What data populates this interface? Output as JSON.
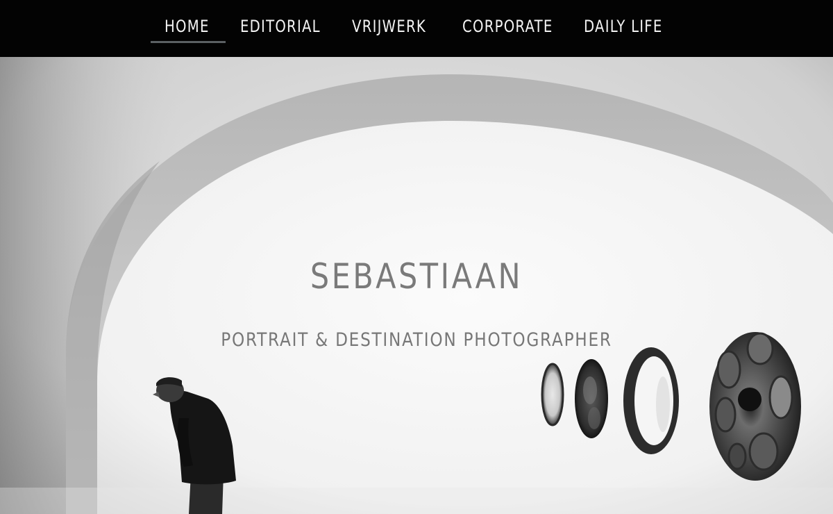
{
  "nav": {
    "items": [
      {
        "label": "HOME",
        "active": true
      },
      {
        "label": "EDITORIAL",
        "active": false
      },
      {
        "label": "VRIJWERK",
        "active": false
      },
      {
        "label": "CORPORATE",
        "active": false
      },
      {
        "label": "DAILY LIFE",
        "active": false
      }
    ]
  },
  "hero": {
    "title": "SEBASTIAAN",
    "subtitle": "PORTRAIT & DESTINATION PHOTOGRAPHER"
  },
  "colors": {
    "navbar_bg": "#030303",
    "nav_text": "#f4f4f4",
    "active_underline": "#5b6063",
    "hero_text": "#7a7a7a"
  }
}
